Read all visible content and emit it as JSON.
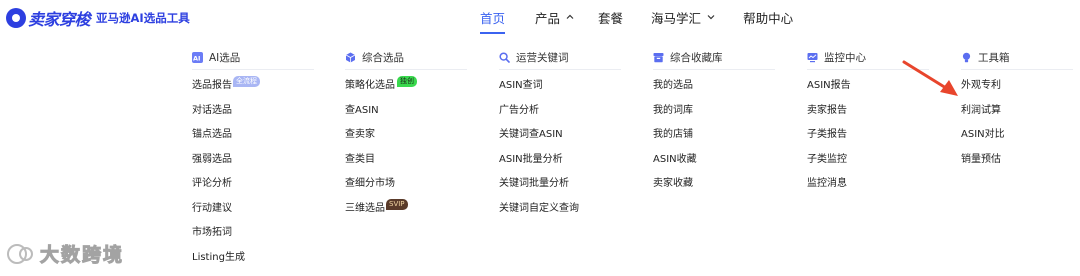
{
  "brand": {
    "name": "卖家穿梭",
    "tagline": "亚马逊AI选品工具",
    "color": "#2d3fe0"
  },
  "nav": {
    "items": [
      {
        "label": "首页",
        "active": true
      },
      {
        "label": "产品",
        "has_caret": true,
        "caret": "chevron-up"
      },
      {
        "label": "套餐"
      },
      {
        "label": "海马学汇",
        "has_caret": true,
        "caret": "chevron-down"
      },
      {
        "label": "帮助中心"
      }
    ],
    "active_color": "#3b63f0"
  },
  "menu": {
    "columns": [
      {
        "title": "AI选品",
        "icon": "ai-icon",
        "items": [
          {
            "label": "选品报告",
            "badge": "全流程"
          },
          {
            "label": "对话选品"
          },
          {
            "label": "锚点选品"
          },
          {
            "label": "强弱选品"
          },
          {
            "label": "评论分析"
          },
          {
            "label": "行动建议"
          },
          {
            "label": "市场拓词"
          },
          {
            "label": "Listing生成"
          }
        ]
      },
      {
        "title": "综合选品",
        "icon": "cube-icon",
        "items": [
          {
            "label": "策略化选品",
            "badge": "独创"
          },
          {
            "label": "查ASIN"
          },
          {
            "label": "查卖家"
          },
          {
            "label": "查类目"
          },
          {
            "label": "查细分市场"
          },
          {
            "label": "三维选品",
            "badge": "SVIP"
          }
        ]
      },
      {
        "title": "运营关键词",
        "icon": "search-icon",
        "items": [
          {
            "label": "ASIN查词"
          },
          {
            "label": "广告分析"
          },
          {
            "label": "关键词查ASIN"
          },
          {
            "label": "ASIN批量分析"
          },
          {
            "label": "关键词批量分析"
          },
          {
            "label": "关键词自定义查询"
          }
        ]
      },
      {
        "title": "综合收藏库",
        "icon": "archive-icon",
        "items": [
          {
            "label": "我的选品"
          },
          {
            "label": "我的词库"
          },
          {
            "label": "我的店铺"
          },
          {
            "label": "ASIN收藏"
          },
          {
            "label": "卖家收藏"
          }
        ]
      },
      {
        "title": "监控中心",
        "icon": "monitor-icon",
        "items": [
          {
            "label": "ASIN报告"
          },
          {
            "label": "卖家报告"
          },
          {
            "label": "子类报告"
          },
          {
            "label": "子类监控"
          },
          {
            "label": "监控消息"
          }
        ]
      },
      {
        "title": "工具箱",
        "icon": "bulb-icon",
        "items": [
          {
            "label": "外观专利"
          },
          {
            "label": "利润试算"
          },
          {
            "label": "ASIN对比"
          },
          {
            "label": "销量预估"
          }
        ]
      }
    ]
  },
  "annotation": {
    "arrow_color": "#e8452c",
    "points_to": "外观专利"
  },
  "watermark": {
    "text": "大数跨境"
  }
}
